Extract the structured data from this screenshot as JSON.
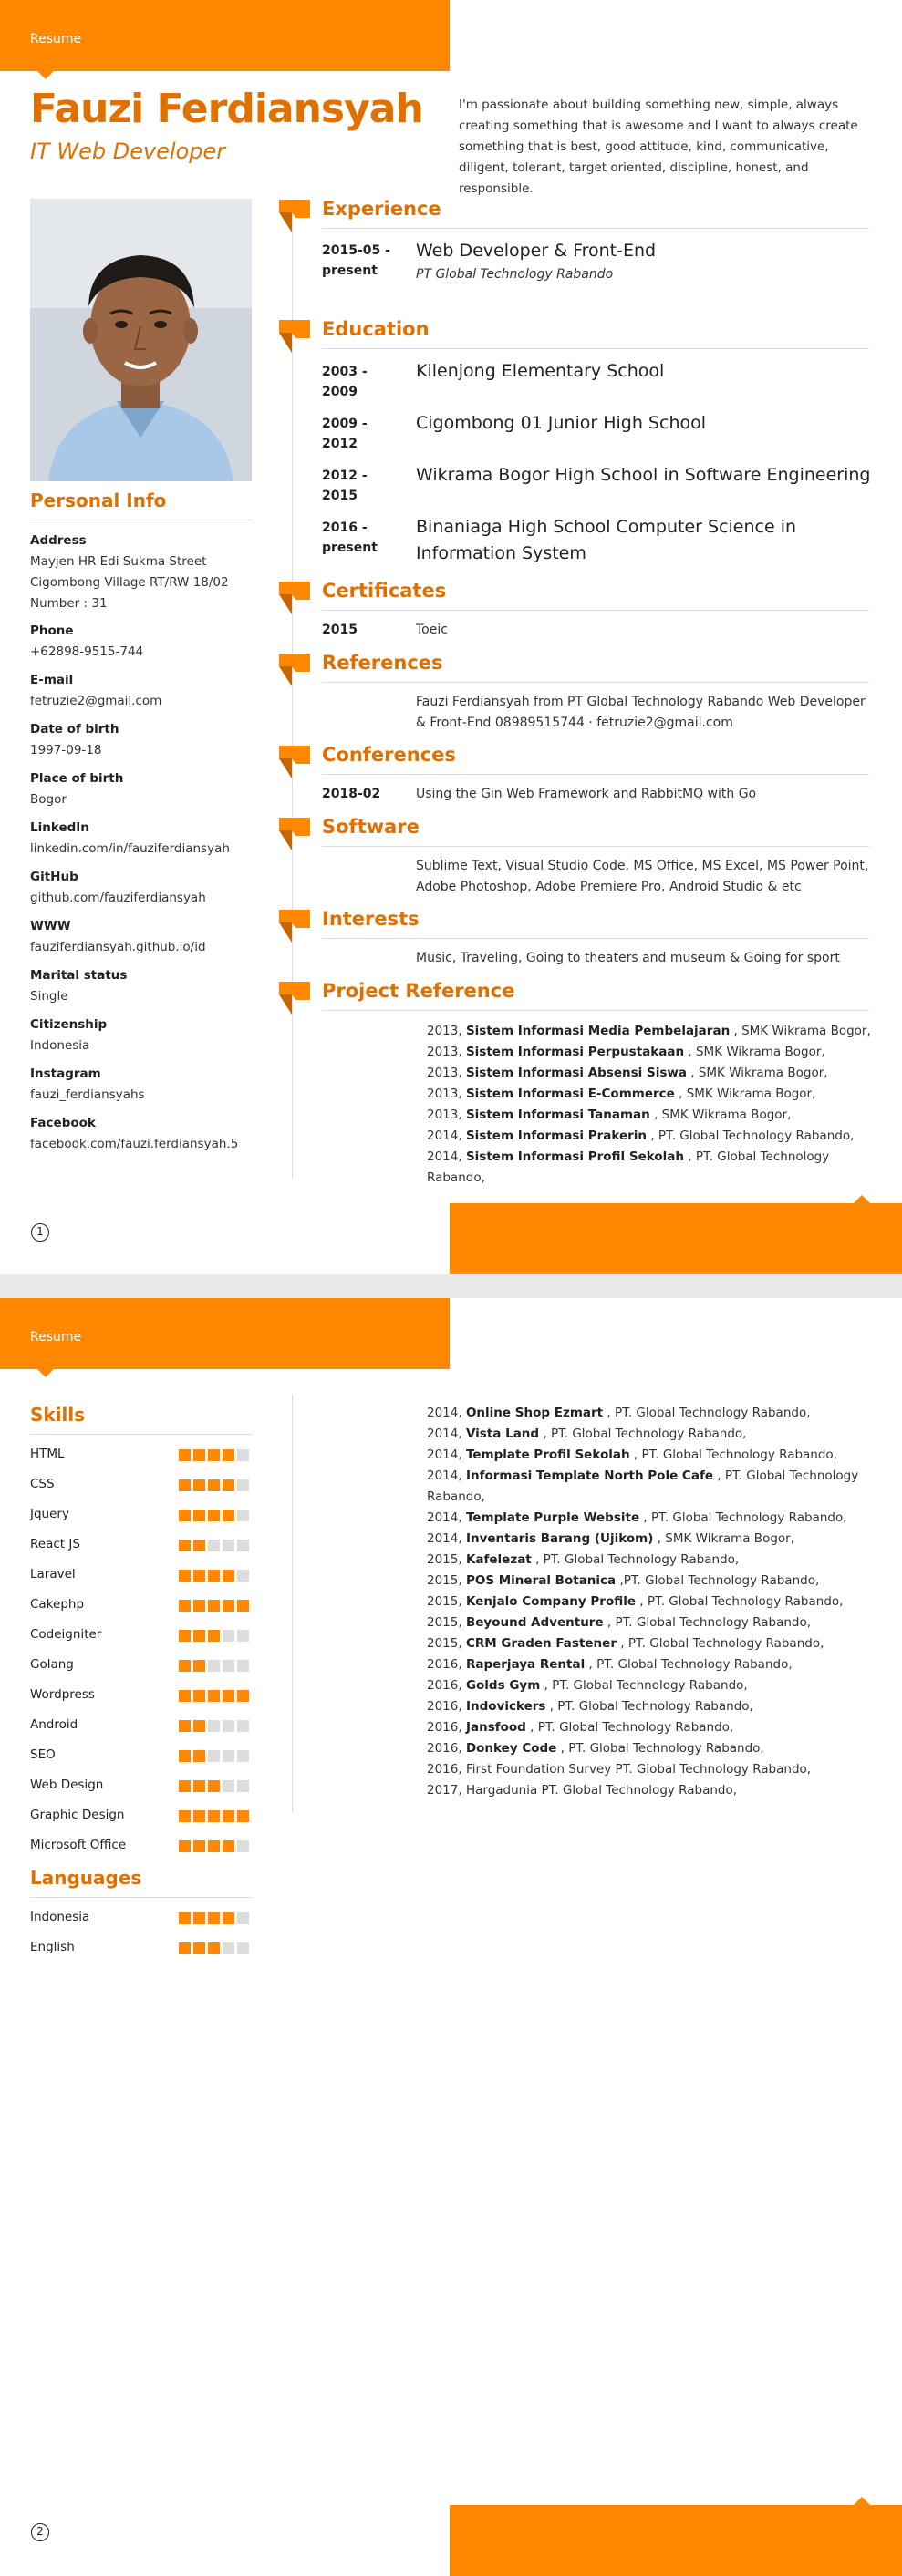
{
  "tab_label": "Resume",
  "name": "Fauzi Ferdiansyah",
  "job_title": "IT Web Developer",
  "summary": "I'm passionate about building something new, simple, always creating something that is awesome and I want to always create something that is best, good attitude, kind, communicative, diligent, tolerant, target oriented, discipline, honest, and responsible.",
  "personal_info": {
    "title": "Personal Info",
    "items": [
      {
        "label": "Address",
        "value": "Mayjen HR Edi Sukma Street Cigombong Village RT/RW 18/02 Number : 31"
      },
      {
        "label": "Phone",
        "value": "+62898-9515-744"
      },
      {
        "label": "E-mail",
        "value": "fetruzie2@gmail.com"
      },
      {
        "label": "Date of birth",
        "value": "1997-09-18"
      },
      {
        "label": "Place of birth",
        "value": "Bogor"
      },
      {
        "label": "LinkedIn",
        "value": "linkedin.com/in/fauziferdiansyah"
      },
      {
        "label": "GitHub",
        "value": "github.com/fauziferdiansyah"
      },
      {
        "label": "WWW",
        "value": "fauziferdiansyah.github.io/id"
      },
      {
        "label": "Marital status",
        "value": "Single"
      },
      {
        "label": "Citizenship",
        "value": "Indonesia"
      },
      {
        "label": "Instagram",
        "value": "fauzi_ferdiansyahs"
      },
      {
        "label": "Facebook",
        "value": "facebook.com/fauzi.ferdiansyah.5"
      }
    ]
  },
  "experience": {
    "title": "Experience",
    "items": [
      {
        "date": "2015-05 - present",
        "title": "Web Developer & Front-End",
        "company": "PT Global Technology Rabando"
      }
    ]
  },
  "education": {
    "title": "Education",
    "items": [
      {
        "date": "2003 - 2009",
        "title": "Kilenjong Elementary School"
      },
      {
        "date": "2009 - 2012",
        "title": "Cigombong 01 Junior High School"
      },
      {
        "date": "2012 - 2015",
        "title": "Wikrama Bogor High School in Software Engineering"
      },
      {
        "date": "2016 - present",
        "title": "Binaniaga High School Computer Science in Information System"
      }
    ]
  },
  "certificates": {
    "title": "Certificates",
    "items": [
      {
        "date": "2015",
        "text": "Toeic"
      }
    ]
  },
  "references": {
    "title": "References",
    "text": "Fauzi Ferdiansyah from PT Global Technology Rabando Web Developer & Front-End 08989515744 · fetruzie2@gmail.com"
  },
  "conferences": {
    "title": "Conferences",
    "items": [
      {
        "date": "2018-02",
        "text": "Using the Gin Web Framework and RabbitMQ with Go"
      }
    ]
  },
  "software": {
    "title": "Software",
    "text": "Sublime Text, Visual Studio Code, MS Office, MS Excel, MS Power Point, Adobe Photoshop, Adobe Premiere Pro, Android Studio & etc"
  },
  "interests": {
    "title": "Interests",
    "text": "Music, Traveling, Going to theaters and museum & Going for sport"
  },
  "project_reference": {
    "title": "Project Reference",
    "page1": [
      {
        "year": "2013,",
        "name": "Sistem Informasi Media Pembelajaran",
        "org": ", SMK Wikrama Bogor,"
      },
      {
        "year": "2013,",
        "name": "Sistem Informasi Perpustakaan",
        "org": ", SMK Wikrama Bogor,"
      },
      {
        "year": "2013,",
        "name": "Sistem Informasi Absensi Siswa",
        "org": ", SMK Wikrama Bogor,"
      },
      {
        "year": "2013,",
        "name": "Sistem Informasi E-Commerce",
        "org": ", SMK Wikrama Bogor,"
      },
      {
        "year": "2013,",
        "name": "Sistem Informasi Tanaman",
        "org": ", SMK Wikrama Bogor,"
      },
      {
        "year": "2014,",
        "name": "Sistem Informasi Prakerin",
        "org": ", PT. Global Technology Rabando,"
      },
      {
        "year": "2014,",
        "name": "Sistem Informasi Profil Sekolah",
        "org": ", PT. Global Technology Rabando,"
      }
    ],
    "page2": [
      {
        "year": "2014,",
        "name": "Online Shop Ezmart",
        "org": ", PT. Global Technology Rabando,"
      },
      {
        "year": "2014,",
        "name": "Vista Land",
        "org": ", PT. Global Technology Rabando,"
      },
      {
        "year": "2014,",
        "name": "Template Profil Sekolah",
        "org": ", PT. Global Technology Rabando,"
      },
      {
        "year": "2014,",
        "name": "Informasi Template North Pole Cafe",
        "org": ", PT. Global Technology Rabando,"
      },
      {
        "year": "2014,",
        "name": "Template Purple Website",
        "org": ", PT. Global Technology Rabando,"
      },
      {
        "year": "2014,",
        "name": "Inventaris Barang (Ujikom)",
        "org": ", SMK Wikrama Bogor,"
      },
      {
        "year": "2015,",
        "name": "Kafelezat",
        "org": ", PT. Global Technology Rabando,"
      },
      {
        "year": "2015,",
        "name": "POS Mineral Botanica",
        "org": " ,PT. Global Technology Rabando,"
      },
      {
        "year": "2015,",
        "name": "Kenjalo Company Profile",
        "org": ", PT. Global Technology Rabando,"
      },
      {
        "year": "2015,",
        "name": "Beyound Adventure",
        "org": ", PT. Global Technology Rabando,"
      },
      {
        "year": "2015,",
        "name": "CRM Graden Fastener",
        "org": ", PT. Global Technology Rabando,"
      },
      {
        "year": "2016,",
        "name": "Raperjaya Rental",
        "org": ", PT. Global Technology Rabando,"
      },
      {
        "year": "2016,",
        "name": "Golds Gym",
        "org": ", PT. Global Technology Rabando,"
      },
      {
        "year": "2016,",
        "name": "Indovickers",
        "org": ", PT. Global Technology Rabando,"
      },
      {
        "year": "2016,",
        "name": "Jansfood",
        "org": ", PT. Global Technology Rabando,"
      },
      {
        "year": "2016,",
        "name": "Donkey Code",
        "org": ", PT. Global Technology Rabando,"
      },
      {
        "year": "2016,",
        "name": "",
        "org": "First Foundation Survey PT. Global Technology Rabando,"
      },
      {
        "year": "2017,",
        "name": "",
        "org": "Hargadunia PT. Global Technology Rabando,"
      }
    ]
  },
  "skills": {
    "title": "Skills",
    "max_level": 5,
    "items": [
      {
        "name": "HTML",
        "level": 4
      },
      {
        "name": "CSS",
        "level": 4
      },
      {
        "name": "Jquery",
        "level": 4
      },
      {
        "name": "React JS",
        "level": 2
      },
      {
        "name": "Laravel",
        "level": 4
      },
      {
        "name": "Cakephp",
        "level": 5
      },
      {
        "name": "Codeigniter",
        "level": 3
      },
      {
        "name": "Golang",
        "level": 2
      },
      {
        "name": "Wordpress",
        "level": 5
      },
      {
        "name": "Android",
        "level": 2
      },
      {
        "name": "SEO",
        "level": 2
      },
      {
        "name": "Web Design",
        "level": 3
      },
      {
        "name": "Graphic Design",
        "level": 5
      },
      {
        "name": "Microsoft Office",
        "level": 4
      }
    ]
  },
  "languages": {
    "title": "Languages",
    "max_level": 5,
    "items": [
      {
        "name": "Indonesia",
        "level": 4
      },
      {
        "name": "English",
        "level": 3
      }
    ]
  },
  "page_numbers": [
    "1",
    "2"
  ],
  "colors": {
    "accent": "#ff8800",
    "accent_text": "#e07000",
    "flag_shadow": "#c76500"
  }
}
